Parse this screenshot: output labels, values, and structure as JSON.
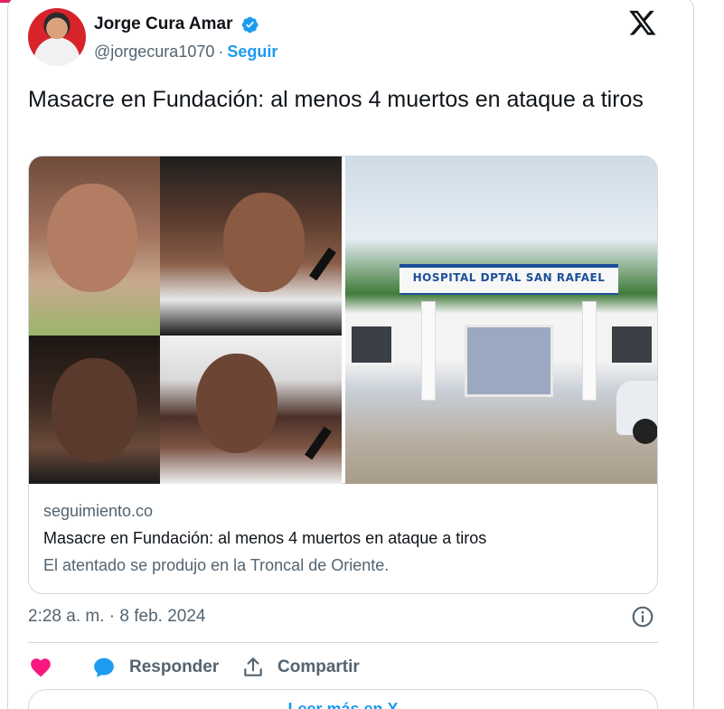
{
  "colors": {
    "accent": "#1d9bf0",
    "text": "#0f1419",
    "muted": "#536471",
    "border": "#cfd9de",
    "like": "#f91880",
    "top_bar": "#e0245e"
  },
  "author": {
    "name": "Jorge Cura Amar",
    "handle": "@jorgecura1070",
    "separator": "·",
    "follow_label": "Seguir",
    "verified_icon": "verified-badge-icon"
  },
  "brand_icon": "x-logo-icon",
  "tweet": {
    "text": "Masacre en Fundación: al menos 4 muertos en ataque a tiros"
  },
  "link_card": {
    "hospital_sign": "HOSPITAL DPTAL SAN RAFAEL",
    "domain": "seguimiento.co",
    "title": "Masacre en Fundación: al menos 4 muertos en ataque a tiros",
    "description": "El atentado se produjo en la Troncal de Oriente."
  },
  "meta": {
    "timestamp": "2:28 a. m. · 8 feb. 2024",
    "info_icon": "info-icon"
  },
  "actions": {
    "like_icon": "heart-icon",
    "reply_label": "Responder",
    "reply_icon": "reply-bubble-icon",
    "share_label": "Compartir",
    "share_icon": "share-upload-icon"
  },
  "read_more_label": "Leer más en X"
}
